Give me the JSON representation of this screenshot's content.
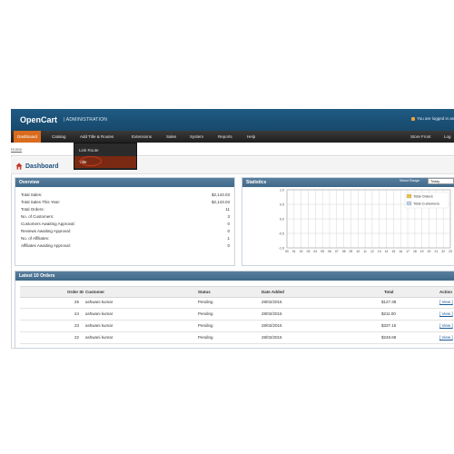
{
  "header": {
    "brand": "OpenCart",
    "subtitle": "| ADMINISTRATION",
    "logged_in": "You are logged in as"
  },
  "menu": [
    {
      "label": "Dashboard",
      "active": true
    },
    {
      "label": "Catalog"
    },
    {
      "label": "Add Title & Routes"
    },
    {
      "label": "Extensions"
    },
    {
      "label": "Sales"
    },
    {
      "label": "System"
    },
    {
      "label": "Reports"
    },
    {
      "label": "Help"
    },
    {
      "label": "Store Front"
    },
    {
      "label": "Log"
    }
  ],
  "dropdown": [
    {
      "label": "Link Route"
    },
    {
      "label": "Title"
    }
  ],
  "breadcrumb": "Home",
  "page_title": "Dashboard",
  "overview": {
    "heading": "Overview",
    "rows": [
      {
        "label": "Total Sales:",
        "value": "$2,143.03"
      },
      {
        "label": "Total Sales This Year:",
        "value": "$2,143.03"
      },
      {
        "label": "Total Orders:",
        "value": "11"
      },
      {
        "label": "No. of Customers:",
        "value": "3"
      },
      {
        "label": "Customers Awaiting Approval:",
        "value": "0"
      },
      {
        "label": "Reviews Awaiting Approval:",
        "value": "0"
      },
      {
        "label": "No. of Affiliates:",
        "value": "1"
      },
      {
        "label": "Affiliates Awaiting Approval:",
        "value": "0"
      }
    ]
  },
  "statistics": {
    "heading": "Statistics",
    "range_label": "Select Range:",
    "range_value": "Today"
  },
  "chart_data": {
    "type": "line",
    "x": [
      "00",
      "01",
      "02",
      "03",
      "04",
      "05",
      "06",
      "07",
      "08",
      "09",
      "10",
      "11",
      "12",
      "13",
      "14",
      "15",
      "16",
      "17",
      "18",
      "19",
      "20",
      "21",
      "22",
      "23"
    ],
    "yticks": [
      "1.0",
      "0.5",
      "0.0",
      "-0.5",
      "-1.0"
    ],
    "ylim": [
      -1.0,
      1.0
    ],
    "series": [
      {
        "name": "Total Orders",
        "color": "#f0c040",
        "values": []
      },
      {
        "name": "Total Customers",
        "color": "#b8cfe6",
        "values": []
      }
    ],
    "legend": "top-right",
    "grid": true
  },
  "latest": {
    "heading": "Latest 10 Orders",
    "columns": [
      "Order ID",
      "Customer",
      "Status",
      "Date Added",
      "Total",
      "Action"
    ],
    "rows": [
      {
        "id": "25",
        "customer": "ashwani kumar",
        "status": "Pending",
        "date": "28/02/2015",
        "total": "$127.38",
        "action": "[ View ]"
      },
      {
        "id": "24",
        "customer": "ashwani kumar",
        "status": "Pending",
        "date": "28/02/2015",
        "total": "$211.00",
        "action": "[ View ]"
      },
      {
        "id": "23",
        "customer": "ashwani kumar",
        "status": "Pending",
        "date": "28/02/2015",
        "total": "$337.15",
        "action": "[ View ]"
      },
      {
        "id": "22",
        "customer": "ashwani kumar",
        "status": "Pending",
        "date": "28/02/2015",
        "total": "$248.68",
        "action": "[ View ]"
      }
    ]
  }
}
